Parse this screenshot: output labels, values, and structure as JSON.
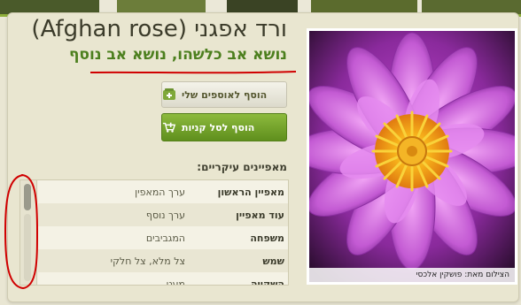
{
  "plant": {
    "title": "ורד אפגני (Afghan rose)",
    "subtitle": "נושא אב כלשהו, נושא אב נוסף",
    "photo_credit": "הצילום מאת: פושקין אלכסי"
  },
  "actions": {
    "add_to_collection": "הוסף לאוספים שלי",
    "add_to_cart": "הוסף לסל קניות"
  },
  "characteristics": {
    "title": "מאפיינים עיקריים:",
    "rows": [
      {
        "key": "מאפיין הראשון",
        "value": "ערך המאפין"
      },
      {
        "key": "עוד מאפיין",
        "value": "ערך נוסף"
      },
      {
        "key": "משפחה",
        "value": "המגביבים"
      },
      {
        "key": "שמש",
        "value": "צל מלא, צל חלקי"
      },
      {
        "key": "השקייה",
        "value": "מעט"
      }
    ]
  },
  "colors": {
    "accent_green": "#6d9b2a",
    "title_text": "#3b3b2a",
    "subtitle_green": "#4c7f1e",
    "annotation_red": "#d00000"
  },
  "icons": [
    "collection-icon",
    "cart-plus-icon"
  ]
}
